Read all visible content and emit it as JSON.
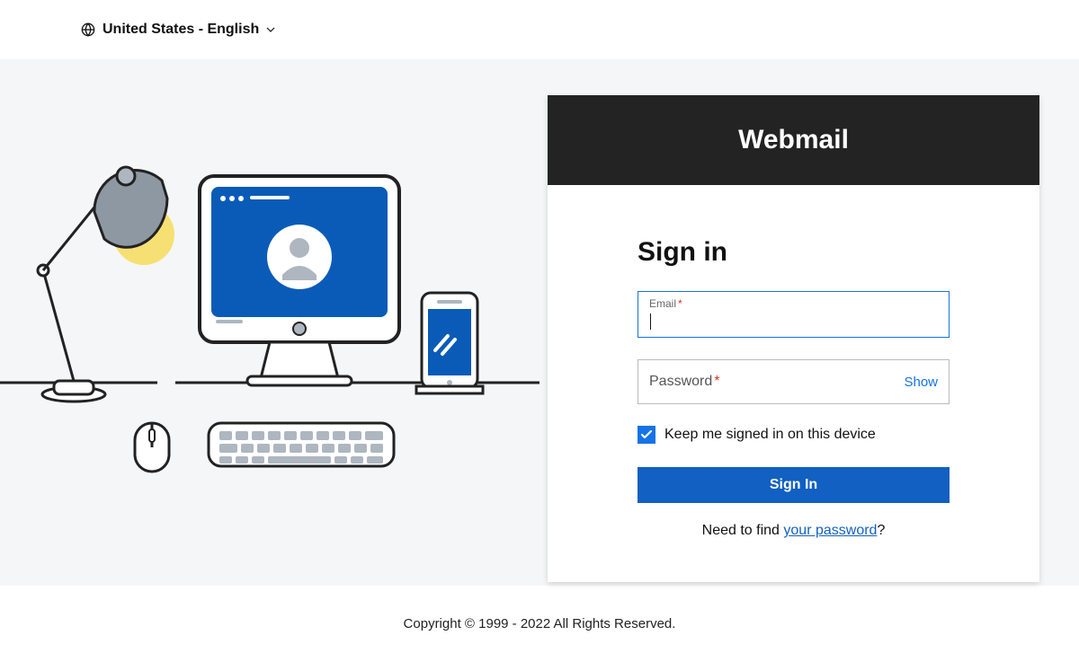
{
  "header": {
    "locale_label": "United States - English"
  },
  "card": {
    "title": "Webmail",
    "sign_in_heading": "Sign in",
    "email_label": "Email",
    "password_label": "Password",
    "show_password_label": "Show",
    "keep_signed_in_label": "Keep me signed in on this device",
    "submit_label": "Sign In",
    "help_prefix": "Need to find ",
    "help_link_text": "your password",
    "help_suffix": "?"
  },
  "footer": {
    "copyright": "Copyright © 1999 - 2022 All Rights Reserved."
  }
}
